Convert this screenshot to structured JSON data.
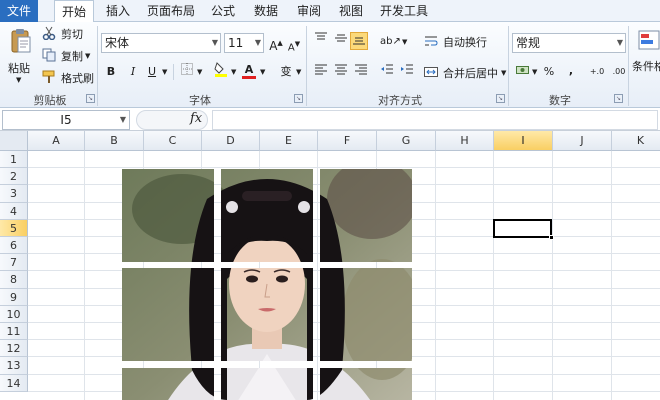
{
  "tabs": [
    {
      "label": "文件",
      "kind": "file"
    },
    {
      "label": "开始",
      "kind": "active"
    },
    {
      "label": "插入"
    },
    {
      "label": "页面布局"
    },
    {
      "label": "公式"
    },
    {
      "label": "数据"
    },
    {
      "label": "审阅"
    },
    {
      "label": "视图"
    },
    {
      "label": "开发工具"
    }
  ],
  "clipboard": {
    "paste": "粘贴",
    "cut": "剪切",
    "copy": "复制",
    "format_painter": "格式刷",
    "group_label": "剪贴板"
  },
  "font": {
    "name": "宋体",
    "size": "11",
    "grow": "A",
    "shrink": "A",
    "bold": "B",
    "italic": "I",
    "underline": "U",
    "color_letter": "A",
    "wen": "变",
    "group_label": "字体"
  },
  "alignment": {
    "wrap_text": "自动换行",
    "merge_center": "合并后居中",
    "group_label": "对齐方式"
  },
  "number": {
    "format": "常规",
    "percent": "%",
    "comma": ",",
    "inc_decimal": "+.0",
    "dec_decimal": ".00",
    "group_label": "数字"
  },
  "styles": {
    "conditional_format": "条件格"
  },
  "formula_bar": {
    "name_box": "I5",
    "fx": "fx",
    "content": ""
  },
  "columns": [
    "A",
    "B",
    "C",
    "D",
    "E",
    "F",
    "G",
    "H",
    "I",
    "J",
    "K"
  ],
  "rows": [
    "1",
    "2",
    "3",
    "4",
    "5",
    "6",
    "7",
    "8",
    "9",
    "10",
    "11",
    "12",
    "13",
    "14"
  ],
  "selected_cell": {
    "column": "I",
    "row": "5"
  },
  "colors": {
    "file_tab": "#2a6ec0",
    "selected_header": "#f9cf63",
    "font_color_bar": "#e02020",
    "fill_color_bar": "#ffff00"
  }
}
